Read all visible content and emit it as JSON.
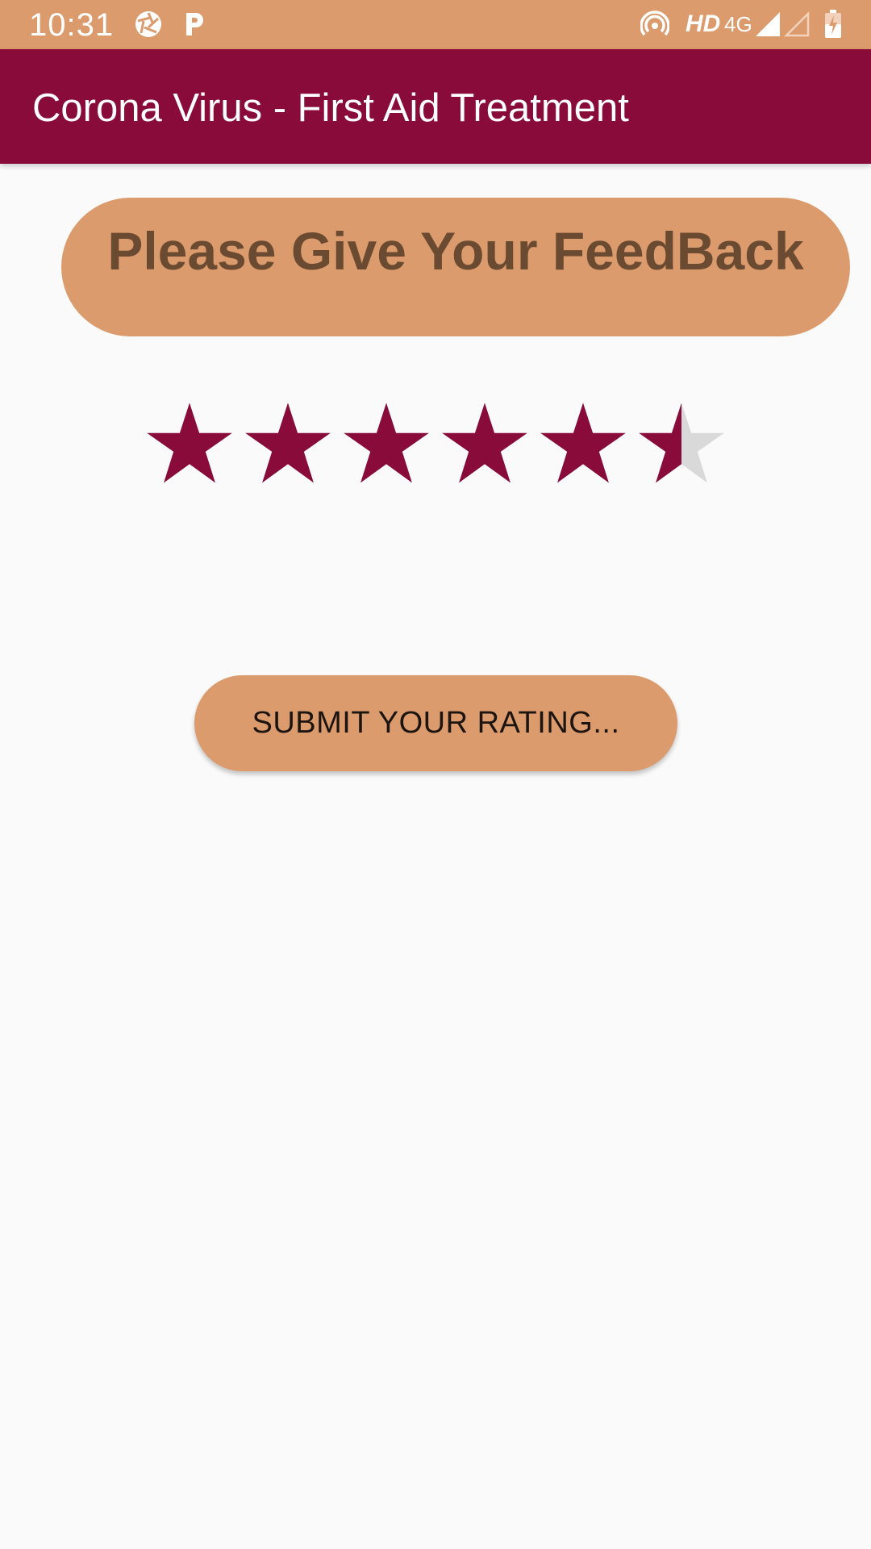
{
  "status_bar": {
    "time": "10:31",
    "hd_label": "HD",
    "network_label": "4G",
    "icons": [
      "aperture-icon",
      "parking-icon",
      "hotspot-icon",
      "signal-icon",
      "signal-empty-icon",
      "battery-charging-icon"
    ]
  },
  "app_bar": {
    "title": "Corona Virus - First Aid Treatment"
  },
  "feedback": {
    "heading": "Please Give Your FeedBack"
  },
  "rating": {
    "value": 5.5,
    "max": 6,
    "filled_color": "#880b3a",
    "empty_color": "#d9d9d9"
  },
  "submit": {
    "label": "SUBMIT YOUR RATING..."
  },
  "colors": {
    "accent": "#dc9b6c",
    "primary": "#880b3a",
    "heading_text": "#6b4a32"
  }
}
